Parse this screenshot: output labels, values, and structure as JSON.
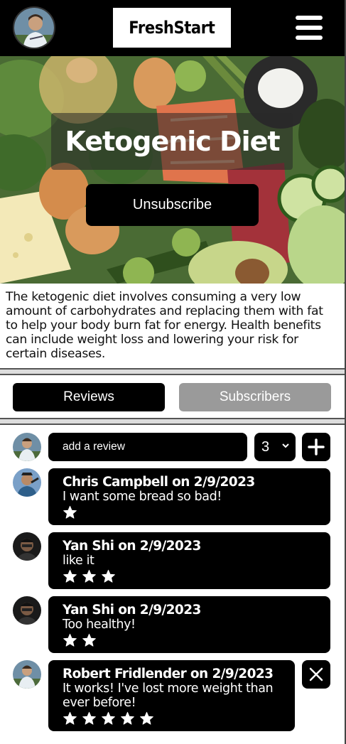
{
  "app": {
    "logo": "FreshStart"
  },
  "hero": {
    "title": "Ketogenic Diet",
    "unsubscribe_label": "Unsubscribe"
  },
  "description": "The ketogenic diet involves consuming a very low amount of carbohydrates and replacing them with fat to help your body burn fat for energy. Health benefits can include weight loss and lowering your risk for certain diseases.",
  "tabs": {
    "reviews_label": "Reviews",
    "subscribers_label": "Subscribers",
    "active": "Reviews"
  },
  "review_form": {
    "placeholder": "add a review",
    "rating_value": "3"
  },
  "reviews": [
    {
      "author_line": "Chris Campbell on 2/9/2023",
      "text": "I want some bread so bad!",
      "stars": 1,
      "deletable": false
    },
    {
      "author_line": "Yan Shi on 2/9/2023",
      "text": "like it",
      "stars": 3,
      "deletable": false
    },
    {
      "author_line": "Yan Shi on 2/9/2023",
      "text": "Too healthy!",
      "stars": 2,
      "deletable": false
    },
    {
      "author_line": "Robert Fridlender on 2/9/2023",
      "text": "It works! I've lost more weight than ever before!",
      "stars": 5,
      "deletable": true
    }
  ],
  "icons": {
    "menu": "hamburger-menu-icon",
    "add": "plus-icon",
    "delete": "close-x-icon",
    "star": "star-icon",
    "dropdown": "chevron-down-icon"
  },
  "colors": {
    "primary": "#000000",
    "inactive_tab": "#9a9a9a",
    "text_on_dark": "#ffffff"
  }
}
